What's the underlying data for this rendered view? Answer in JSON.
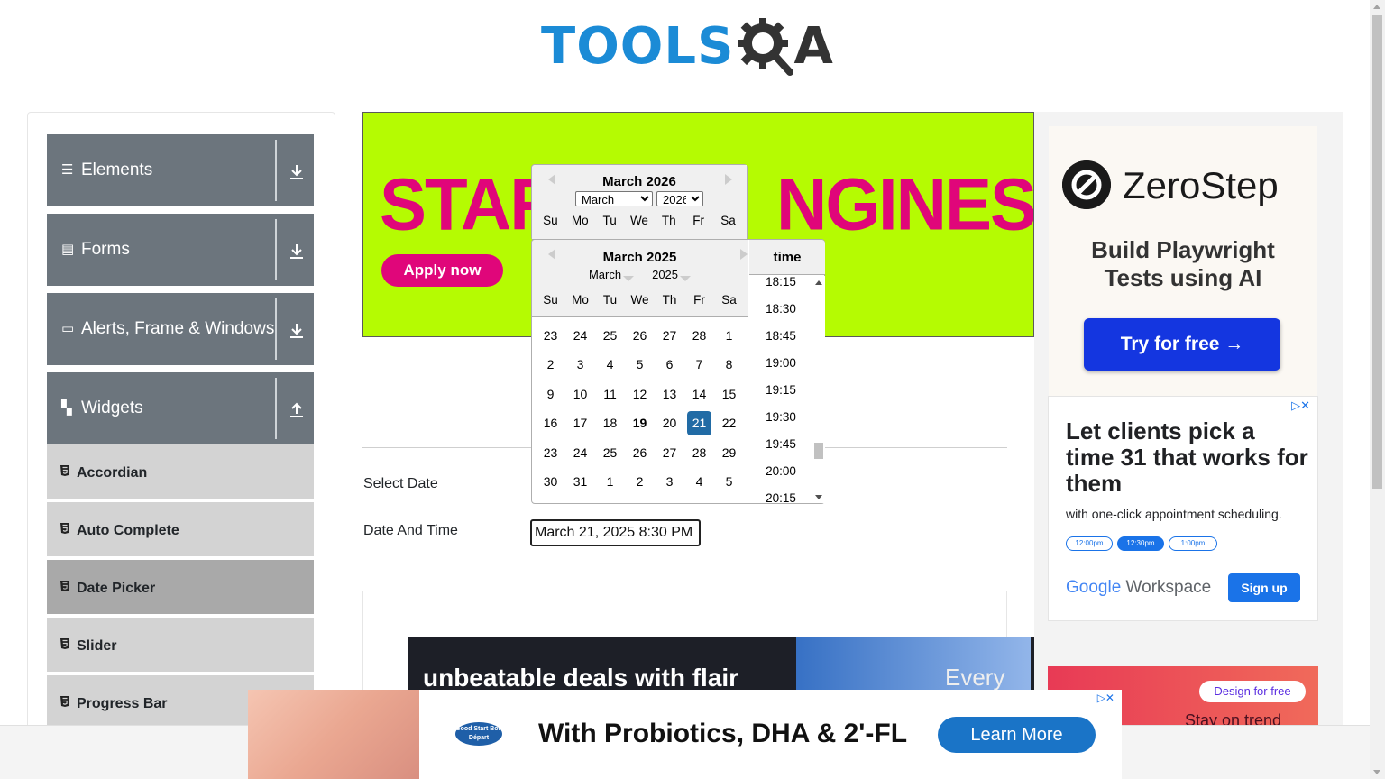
{
  "logo": {
    "tools": "TOOLS",
    "q_icon": "gear-magnifier-icon",
    "a": "A"
  },
  "sidebar": {
    "groups": [
      {
        "label": "Elements",
        "icon": "hamburger-icon"
      },
      {
        "label": "Forms",
        "icon": "document-icon"
      },
      {
        "label": "Alerts, Frame & Windows",
        "icon": "window-icon"
      },
      {
        "label": "Widgets",
        "icon": "grid-icon"
      }
    ],
    "items": [
      {
        "label": "Accordian",
        "active": false
      },
      {
        "label": "Auto Complete",
        "active": false
      },
      {
        "label": "Date Picker",
        "active": true
      },
      {
        "label": "Slider",
        "active": false
      },
      {
        "label": "Progress Bar",
        "active": false
      }
    ]
  },
  "banner": {
    "headline_left": "START",
    "headline_right": "NGINES",
    "cta": "Apply now"
  },
  "form": {
    "select_date_label": "Select Date",
    "date_time_label": "Date And Time",
    "date_time_value": "March 21, 2025 8:30 PM"
  },
  "back_picker": {
    "title": "March 2026",
    "month_select": "March",
    "year_select": "2026",
    "day_names": [
      "Su",
      "Mo",
      "Tu",
      "We",
      "Th",
      "Fr",
      "Sa"
    ]
  },
  "front_picker": {
    "title": "March 2025",
    "month_label": "March",
    "year_label": "2025",
    "day_names": [
      "Su",
      "Mo",
      "Tu",
      "We",
      "Th",
      "Fr",
      "Sa"
    ],
    "weeks": [
      [
        "23",
        "24",
        "25",
        "26",
        "27",
        "28",
        "1"
      ],
      [
        "2",
        "3",
        "4",
        "5",
        "6",
        "7",
        "8"
      ],
      [
        "9",
        "10",
        "11",
        "12",
        "13",
        "14",
        "15"
      ],
      [
        "16",
        "17",
        "18",
        "19",
        "20",
        "21",
        "22"
      ],
      [
        "23",
        "24",
        "25",
        "26",
        "27",
        "28",
        "29"
      ],
      [
        "30",
        "31",
        "1",
        "2",
        "3",
        "4",
        "5"
      ]
    ],
    "today": "19",
    "selected": "21",
    "time_header": "time",
    "times": [
      "18:15",
      "18:30",
      "18:45",
      "19:00",
      "19:15",
      "19:30",
      "19:45",
      "20:00",
      "20:15"
    ]
  },
  "ads": {
    "zerostep": {
      "brand": "ZeroStep",
      "headline": "Build Playwright Tests using AI",
      "cta": "Try for free →"
    },
    "google": {
      "headline": "Let clients pick a time 31 that works for them",
      "sub": "with one-click appointment scheduling.",
      "slots": [
        "12:00pm",
        "12:30pm",
        "1:00pm"
      ],
      "brand_g": "Google",
      "brand_w": " Workspace",
      "cta": "Sign up"
    },
    "canva": {
      "cta": "Design for free",
      "tag": "Stay on trend"
    },
    "flair": {
      "text": "unbeatable deals with flair",
      "right": "Every da"
    },
    "bottom": {
      "badge": "Good Start Bon Départ",
      "claim": "With Probiotics, DHA & 2'-FL",
      "cta": "Learn More"
    }
  }
}
